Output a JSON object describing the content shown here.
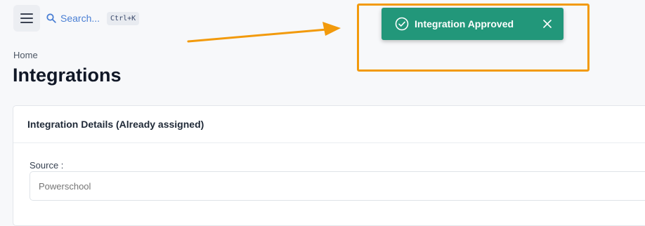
{
  "header": {
    "menu_icon": "hamburger-menu-icon",
    "search_icon": "search-icon",
    "search_label": "Search...",
    "search_shortcut": "Ctrl+K"
  },
  "breadcrumb": "Home",
  "page_title": "Integrations",
  "card": {
    "title": "Integration Details (Already assigned)",
    "source_label": "Source :",
    "source_placeholder": "Powerschool"
  },
  "toast": {
    "message": "Integration Approved",
    "icon": "check-circle-icon",
    "close_icon": "close-icon",
    "color": "#22977a"
  },
  "annotation": {
    "highlight_color": "#f29a0c",
    "arrow_color": "#f29a0c"
  }
}
